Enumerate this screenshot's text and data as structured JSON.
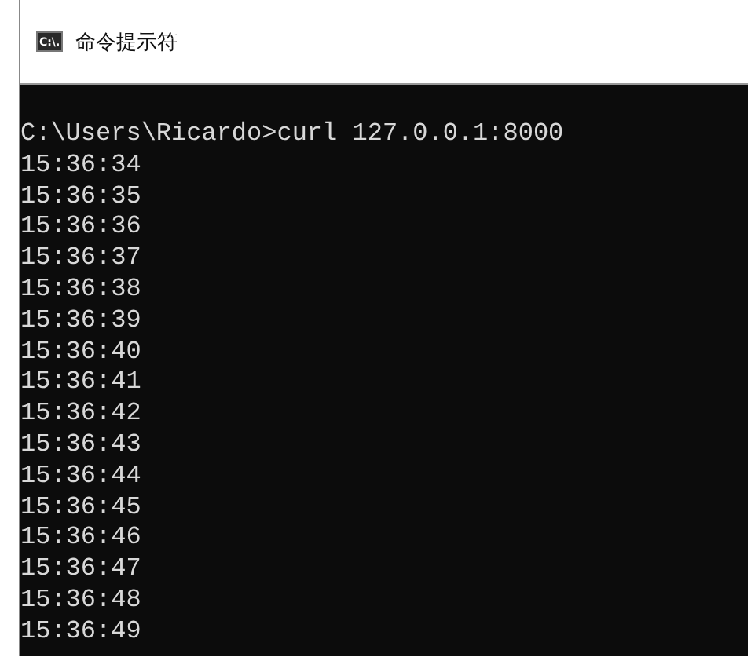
{
  "window": {
    "title": "命令提示符",
    "icon_label": "C:\\."
  },
  "console": {
    "lines": [
      "C:\\Users\\Ricardo>curl 127.0.0.1:8000",
      "15:36:34",
      "15:36:35",
      "15:36:36",
      "15:36:37",
      "15:36:38",
      "15:36:39",
      "15:36:40",
      "15:36:41",
      "15:36:42",
      "15:36:43",
      "15:36:44",
      "15:36:45",
      "15:36:46",
      "15:36:47",
      "15:36:48",
      "15:36:49"
    ]
  }
}
